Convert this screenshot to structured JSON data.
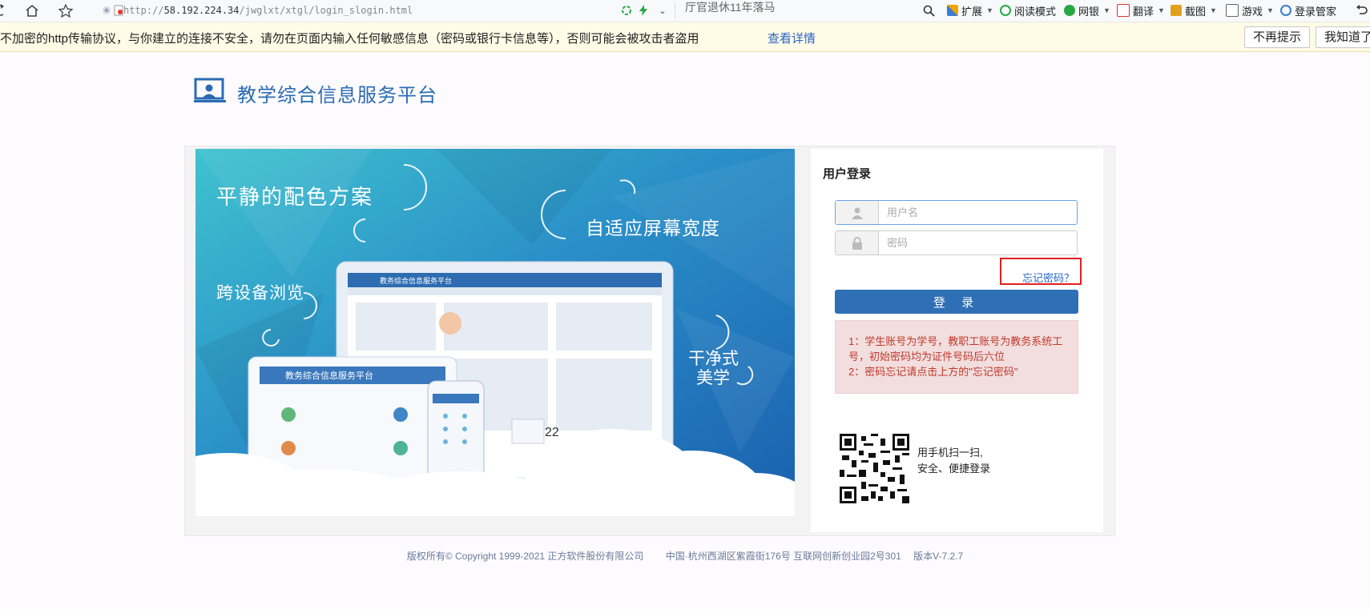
{
  "browser": {
    "url_prefix": "http://",
    "url_host": "58.192.224.34",
    "url_path": "/jwglxt/xtgl/login_slogin.html",
    "search_hint": "厅官退休11年落马",
    "toolbar_items": [
      "扩展",
      "阅读模式",
      "网银",
      "翻译",
      "截图",
      "游戏",
      "登录管家"
    ],
    "security_warning": "不加密的http传输协议，与你建立的连接不安全，请勿在页面内输入任何敏感信息（密码或银行卡信息等），否则可能会被攻击者盗用",
    "warning_link": "查看详情",
    "btn_dont_remind": "不再提示",
    "btn_got_it": "我知道了"
  },
  "header": {
    "site_title": "教学综合信息服务平台"
  },
  "banner": {
    "slogan_colors": "平静的配色方案",
    "slogan_adaptive": "自适应屏幕宽度",
    "slogan_cross_device": "跨设备浏览",
    "slogan_clean_1": "干净式",
    "slogan_clean_2": "美学",
    "screen_title": "教务综合信息服务平台",
    "tablet_title": "教务综合信息服务平台",
    "calendar_day": "22"
  },
  "login": {
    "title": "用户登录",
    "username_placeholder": "用户名",
    "password_placeholder": "密码",
    "forgot_link": "忘记密码？",
    "submit_label": "登 录",
    "notice_lines": [
      "1：学生账号为学号，教职工账号为教务系统工号，初始密码均为证件号码后六位",
      "2：密码忘记请点击上方的\"忘记密码\""
    ],
    "qr_text_1": "用手机扫一扫,",
    "qr_text_2": "安全、便捷登录"
  },
  "footer": {
    "copyright": "版权所有© Copyright 1999-2021 正方软件股份有限公司",
    "address": "中国·杭州西湖区紫霞街176号 互联网创新创业园2号301",
    "version": "版本V-7.2.7"
  },
  "colors": {
    "brand_blue": "#2b6bb3",
    "button_blue": "#2f6fb5",
    "notice_red": "#c0392b",
    "notice_bg": "#f2dede",
    "forgot_highlight": "#e02020"
  }
}
